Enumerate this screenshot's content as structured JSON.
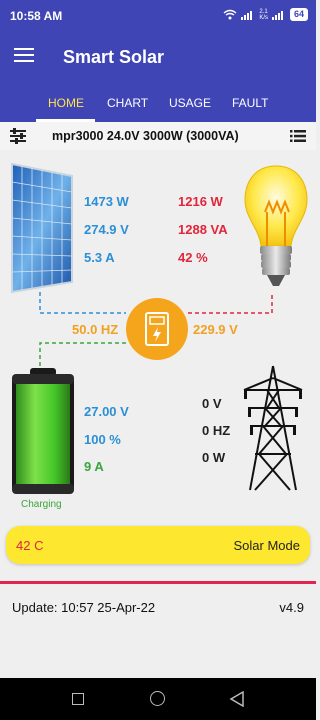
{
  "status": {
    "time": "10:58 AM",
    "net_speed": "2.1\nK/s",
    "battery": "64"
  },
  "app": {
    "title": "Smart Solar"
  },
  "tabs": [
    {
      "label": "HOME",
      "active": true
    },
    {
      "label": "CHART"
    },
    {
      "label": "USAGE"
    },
    {
      "label": "FAULT"
    }
  ],
  "device": {
    "title": "mpr3000 24.0V 3000W (3000VA)"
  },
  "solar": {
    "power": "1473 W",
    "voltage": "274.9 V",
    "current": "5.3 A"
  },
  "load": {
    "power": "1216 W",
    "apparent": "1288 VA",
    "percent": "42 %"
  },
  "inverter": {
    "frequency": "50.0 HZ",
    "output_voltage": "229.9 V"
  },
  "battery": {
    "voltage": "27.00 V",
    "percent": "100 %",
    "current": "9 A",
    "state": "Charging",
    "level": 1.0
  },
  "grid": {
    "voltage": "0 V",
    "frequency": "0 HZ",
    "power": "0 W"
  },
  "mode_bar": {
    "temperature": "42 C",
    "mode": "Solar Mode"
  },
  "footer": {
    "update": "Update: 10:57 25-Apr-22",
    "version": "v4.9"
  },
  "colors": {
    "primary": "#3f45b5",
    "accent_tab": "#ffe24d",
    "blue": "#2b8fd6",
    "red": "#e0263c",
    "orange": "#f1a120",
    "green": "#3aa63a",
    "mode_bar": "#fde82f"
  },
  "icons": [
    "menu-icon",
    "sliders-icon",
    "list-icon",
    "wifi-icon",
    "signal-icon",
    "battery-icon",
    "solar-panel-icon",
    "light-bulb-icon",
    "inverter-icon",
    "battery-large-icon",
    "power-tower-icon"
  ]
}
